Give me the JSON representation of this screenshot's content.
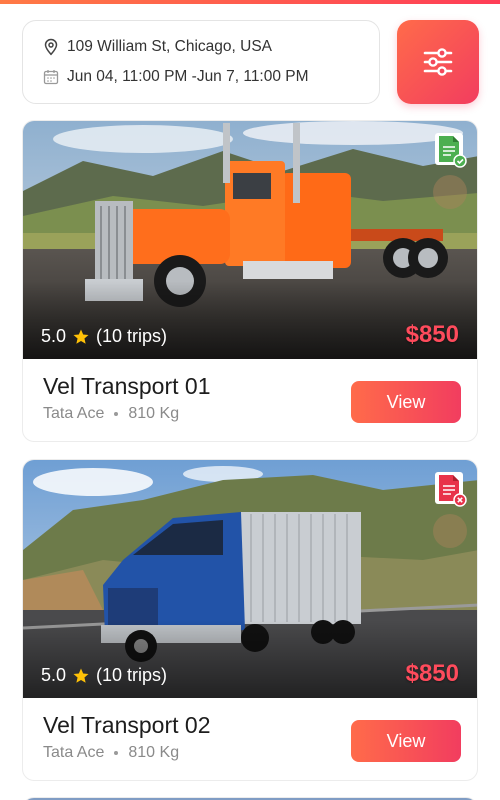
{
  "search": {
    "location": "109 William St, Chicago, USA",
    "dates": "Jun 04, 11:00 PM -Jun 7, 11:00 PM"
  },
  "colors": {
    "accent": "#f23d5f",
    "accent_start": "#ff6b4a",
    "star": "#ffc107"
  },
  "vehicles": [
    {
      "rating": "5.0",
      "trips": "(10 trips)",
      "price": "$850",
      "name": "Vel Transport 01",
      "model": "Tata Ace",
      "capacity": "810 Kg",
      "doc_status": "verified",
      "button": "View"
    },
    {
      "rating": "5.0",
      "trips": "(10 trips)",
      "price": "$850",
      "name": "Vel Transport 02",
      "model": "Tata Ace",
      "capacity": "810 Kg",
      "doc_status": "rejected",
      "button": "View"
    }
  ]
}
